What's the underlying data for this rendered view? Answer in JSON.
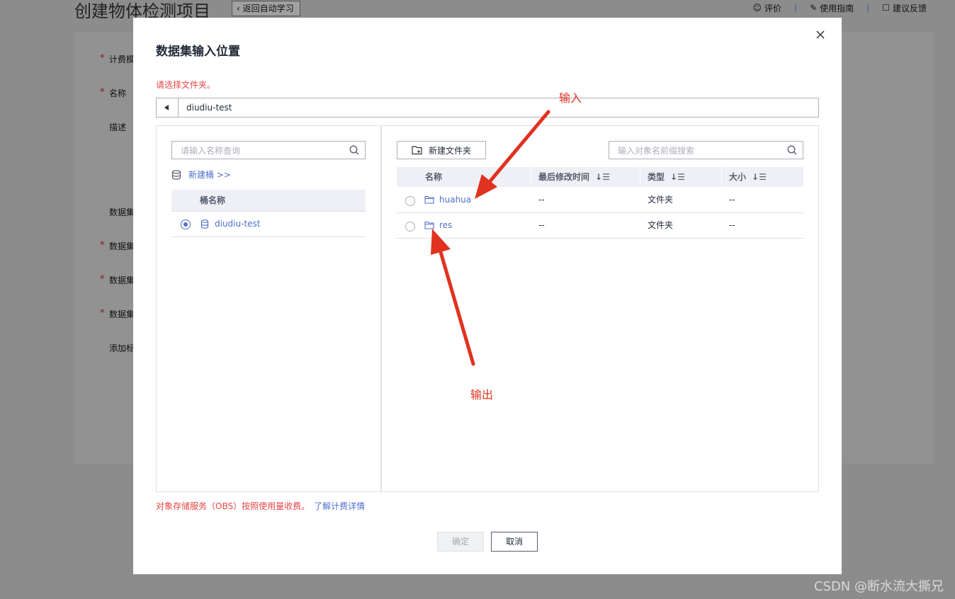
{
  "background": {
    "page_title": "创建物体检测项目",
    "back_button": "返回自动学习",
    "top_links": [
      "评价",
      "使用指南",
      "建议反馈"
    ],
    "form_labels": [
      "计费模",
      "名称",
      "描述",
      "数据集",
      "数据集",
      "数据集",
      "数据集",
      "添加标"
    ]
  },
  "dialog": {
    "title": "数据集输入位置",
    "hint": "请选择文件夹。",
    "path": "diudiu-test",
    "left": {
      "search_placeholder": "请输入名称查询",
      "new_bucket": "新建桶 >>",
      "column": "桶名称",
      "buckets": [
        {
          "name": "diudiu-test",
          "selected": true
        }
      ]
    },
    "right": {
      "new_folder": "新建文件夹",
      "search_placeholder": "输入对象名前缀搜索",
      "columns": [
        "名称",
        "最后修改时间",
        "类型",
        "大小"
      ],
      "rows": [
        {
          "name": "huahua",
          "modified": "--",
          "type": "文件夹",
          "size": "--"
        },
        {
          "name": "res",
          "modified": "--",
          "type": "文件夹",
          "size": "--"
        }
      ]
    },
    "footnote": "对象存储服务（OBS）按照使用量收费。",
    "footnote_link": "了解计费详情",
    "ok_label": "确定",
    "cancel_label": "取消"
  },
  "annotations": {
    "input": "输入",
    "output": "输出",
    "color": "#e0321e"
  },
  "watermark": "CSDN @断水流大撕兄"
}
